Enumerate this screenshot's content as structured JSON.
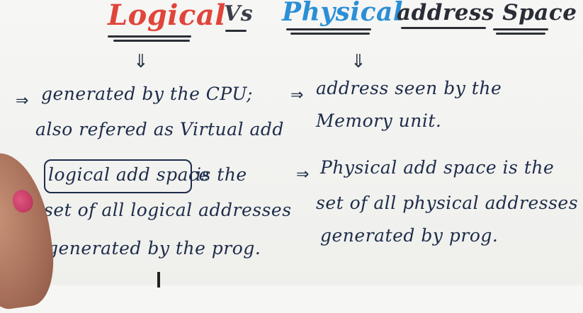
{
  "title": {
    "logical": "Logical",
    "vs": "Vs",
    "physical": "Physical",
    "address_space": "address Space"
  },
  "left_column": {
    "arrow": "⇓",
    "bullet1_line1": "generated by the CPU;",
    "bullet1_line2": "also refered as Virtual add",
    "bullet2_boxed": "logical add space",
    "bullet2_rest": "is the",
    "bullet2_line2": "set of all logical addresses",
    "bullet2_line3": "generated by the prog."
  },
  "right_column": {
    "arrow": "⇓",
    "bullet1_line1": "address seen by the",
    "bullet1_line2": "Memory unit.",
    "bullet2_line1": "Physical add space is the",
    "bullet2_line2": "set of all physical addresses",
    "bullet2_line3": "generated by prog."
  },
  "bullet_symbol": "⇒",
  "colors": {
    "logical": "#e0453a",
    "physical": "#2b8fd6",
    "ink": "#1d2c4a",
    "nail_polish": "#c23a62"
  }
}
